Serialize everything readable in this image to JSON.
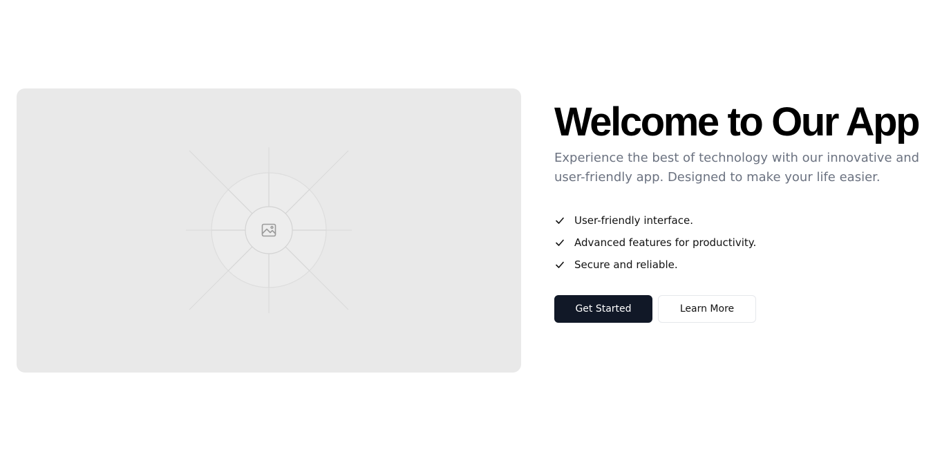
{
  "hero": {
    "image_alt_icon": "image-icon",
    "title": "Welcome to Our App",
    "subtitle": "Experience the best of technology with our innovative and user-friendly app. Designed to make your life easier.",
    "features": [
      {
        "icon": "check-icon",
        "label": "User-friendly interface."
      },
      {
        "icon": "check-icon",
        "label": "Advanced features for productivity."
      },
      {
        "icon": "check-icon",
        "label": "Secure and reliable."
      }
    ],
    "buttons": {
      "primary_label": "Get Started",
      "secondary_label": "Learn More"
    }
  },
  "colors": {
    "primary_button_bg": "#111827",
    "placeholder_bg": "#e9e9e9",
    "subtitle_text": "#6b7280"
  }
}
